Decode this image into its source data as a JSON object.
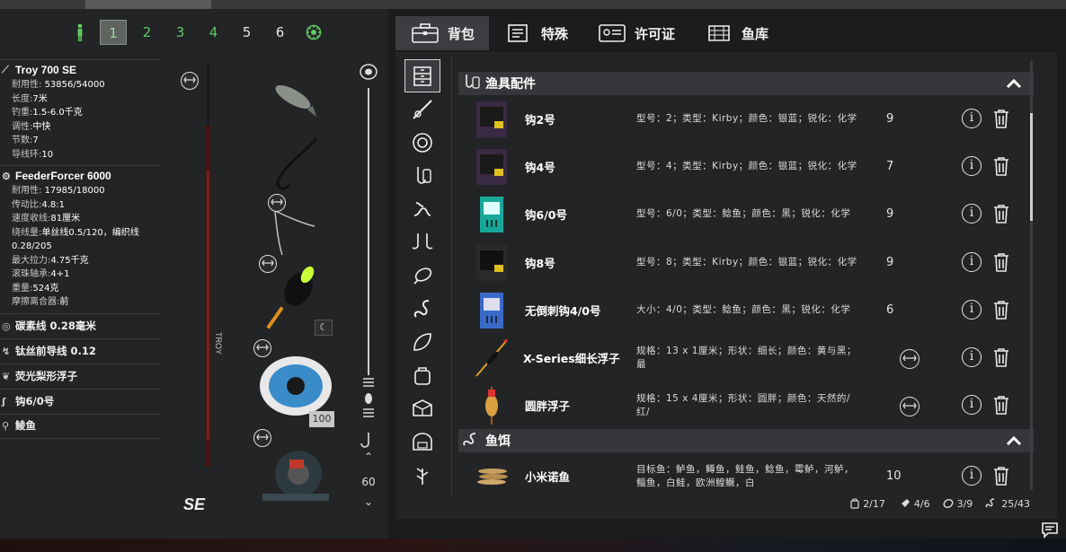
{
  "slots": {
    "items": [
      "1",
      "2",
      "3",
      "4",
      "5",
      "6"
    ],
    "selected": "1"
  },
  "rods": [
    {
      "name": "Troy 700 SE",
      "specs": [
        {
          "label": "耐用性:",
          "value": "53856/54000"
        },
        {
          "label": "长度:",
          "value": "7米"
        },
        {
          "label": "钓重:",
          "value": "1.5-6.0千克"
        },
        {
          "label": "调性:",
          "value": "中快"
        },
        {
          "label": "节数:",
          "value": "7"
        },
        {
          "label": "导线环:",
          "value": "10"
        }
      ]
    },
    {
      "name": "FeederForcer 6000",
      "specs": [
        {
          "label": "耐用性:",
          "value": "17985/18000"
        },
        {
          "label": "传动比:",
          "value": "4.8:1"
        },
        {
          "label": "速度收线:",
          "value": "81厘米"
        },
        {
          "label": "绕线量:",
          "value": "单丝线0.5/120，编织线0.28/205"
        },
        {
          "label": "最大拉力:",
          "value": "4.75千克"
        },
        {
          "label": "滚珠轴承:",
          "value": "4+1"
        },
        {
          "label": "重量:",
          "value": "524克"
        },
        {
          "label": "摩擦离合器:",
          "value": "前"
        }
      ]
    }
  ],
  "tackle": [
    "碳素线 0.28毫米",
    "钛丝前导线 0.12",
    "荧光梨形浮子",
    "钩6/0号",
    "鲮鱼"
  ],
  "reel_line_badge": "100",
  "depth": {
    "value": "60"
  },
  "tabs": [
    "背包",
    "特殊",
    "许可证",
    "鱼库"
  ],
  "group1": {
    "title": "渔具配件"
  },
  "group2": {
    "title": "鱼饵"
  },
  "items": [
    {
      "name": "钩2号",
      "desc": "型号：2；类型：Kirby；颜色：银蓝；锐化：化学",
      "qty": "9"
    },
    {
      "name": "钩4号",
      "desc": "型号：4；类型：Kirby；颜色：银蓝；锐化：化学",
      "qty": "7"
    },
    {
      "name": "钩6/0号",
      "desc": "型号：6/0；类型：鲶鱼；颜色：黑；锐化：化学",
      "qty": "9"
    },
    {
      "name": "钩8号",
      "desc": "型号：8；类型：Kirby；颜色：银蓝；锐化：化学",
      "qty": "9"
    },
    {
      "name": "无倒刺钩4/0号",
      "desc": "大小：4/0；类型：鲶鱼；颜色：黑；锐化：化学",
      "qty": "6"
    },
    {
      "name": "X-Series细长浮子",
      "desc": "规格：13 x 1厘米；形状：细长；颜色：黄与黑；最",
      "qty": ""
    },
    {
      "name": "圆胖浮子",
      "desc": "规格：15 x 4厘米；形状：圆胖；颜色：天然的/红/",
      "qty": ""
    }
  ],
  "bait": {
    "name": "小米诺鱼",
    "desc": "目标鱼：鲈鱼，鳟鱼，鲑鱼，鲶鱼，霉鲈，河鲈，鲻鱼，白鲑，欧洲鳇鳜，白",
    "qty": "10"
  },
  "footer": {
    "slots": "2/17",
    "lures": "4/6",
    "lines": "3/9",
    "baits": "25/43"
  },
  "colors": {
    "panel": "#232426",
    "header": "#35373a",
    "accent_green": "#5ecb62"
  }
}
